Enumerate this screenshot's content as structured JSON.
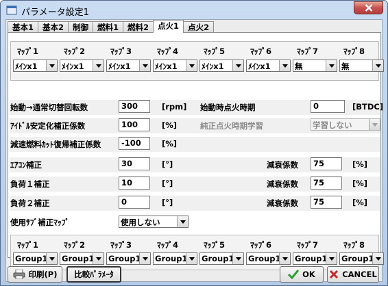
{
  "window": {
    "title": "パラメータ設定1"
  },
  "tabs": [
    {
      "label": "基本1",
      "active": false
    },
    {
      "label": "基本2",
      "active": false
    },
    {
      "label": "制御",
      "active": false
    },
    {
      "label": "燃料1",
      "active": false
    },
    {
      "label": "燃料2",
      "active": false
    },
    {
      "label": "点火1",
      "active": true
    },
    {
      "label": "点火2",
      "active": false
    }
  ],
  "maps_top": {
    "labels": [
      "ﾏｯﾌﾟ1",
      "ﾏｯﾌﾟ2",
      "ﾏｯﾌﾟ3",
      "ﾏｯﾌﾟ4",
      "ﾏｯﾌﾟ5",
      "ﾏｯﾌﾟ6",
      "ﾏｯﾌﾟ7",
      "ﾏｯﾌﾟ8"
    ],
    "values": [
      "ﾒｲﾝx1",
      "ﾒｲﾝx1",
      "ﾒｲﾝx1",
      "ﾒｲﾝx1",
      "ﾒｲﾝx1",
      "ﾒｲﾝx1",
      "無",
      "無"
    ]
  },
  "params": {
    "start_switch_rpm": {
      "label": "始動→通常切替回転数",
      "value": "300",
      "unit": "[rpm]"
    },
    "start_ignition": {
      "label": "始動時点火時期",
      "value": "0",
      "unit": "[BTDC]"
    },
    "idle_coef": {
      "label": "ｱｲﾄﾞﾙ安定化補正係数",
      "value": "100",
      "unit": "[%]"
    },
    "learn": {
      "label": "純正点火時期学習",
      "value": "学習しない"
    },
    "decel_coef": {
      "label": "減速燃料ｶｯﾄ復帰補正係数",
      "value": "-100",
      "unit": "[%]"
    },
    "ac": {
      "label": "ｴｱｺﾝ補正",
      "value": "30",
      "unit": "[°]",
      "decay_label": "減衰係数",
      "decay_value": "75",
      "decay_unit": "[%]"
    },
    "load1": {
      "label": "負荷１補正",
      "value": "10",
      "unit": "[°]",
      "decay_label": "減衰係数",
      "decay_value": "75",
      "decay_unit": "[%]"
    },
    "load2": {
      "label": "負荷２補正",
      "value": "0",
      "unit": "[°]",
      "decay_label": "減衰係数",
      "decay_value": "75",
      "decay_unit": "[%]"
    },
    "submap": {
      "label": "使用ｻﾌﾞ補正ﾏｯﾌﾟ",
      "value": "使用しない"
    }
  },
  "maps_bottom": {
    "labels": [
      "ﾏｯﾌﾟ1",
      "ﾏｯﾌﾟ2",
      "ﾏｯﾌﾟ3",
      "ﾏｯﾌﾟ4",
      "ﾏｯﾌﾟ5",
      "ﾏｯﾌﾟ6",
      "ﾏｯﾌﾟ7",
      "ﾏｯﾌﾟ8"
    ],
    "values": [
      "Group1",
      "Group1",
      "Group1",
      "Group1",
      "Group1",
      "Group1",
      "Group1",
      "Group1"
    ]
  },
  "buttons": {
    "print": "印刷(P)",
    "compare": "比較ﾊﾟﾗﾒｰﾀ",
    "ok": "OK",
    "cancel": "CANCEL"
  },
  "colors": {
    "ok_check": "#2e9a2e",
    "cancel_x": "#c0282a",
    "close_red": "#c75050"
  }
}
